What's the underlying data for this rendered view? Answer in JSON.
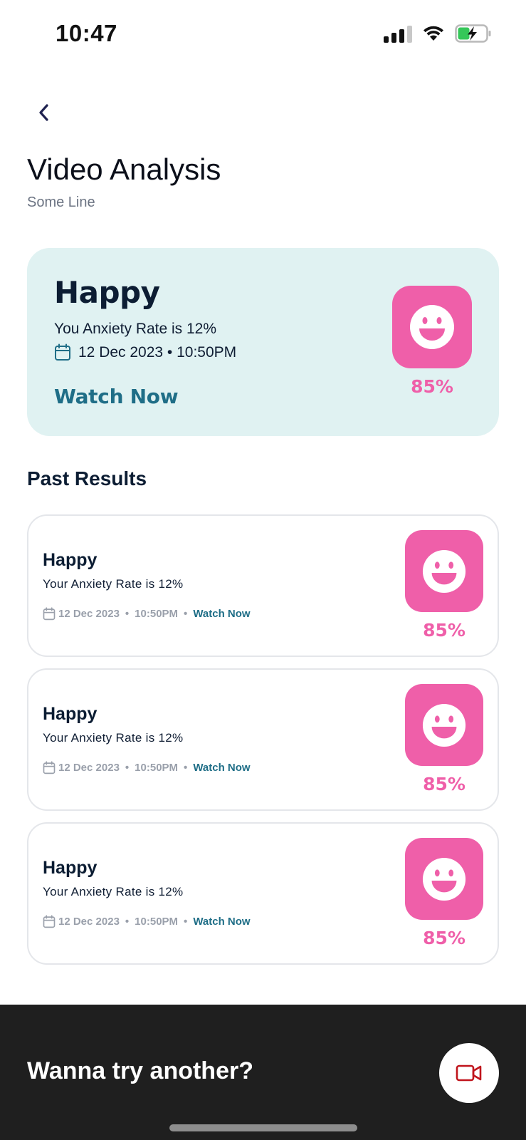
{
  "status_bar": {
    "time": "10:47",
    "icons": [
      "cellular-signal-icon",
      "wifi-icon",
      "battery-charging-icon"
    ]
  },
  "header": {
    "back_icon": "chevron-left-icon",
    "title": "Video Analysis",
    "subtitle": "Some Line"
  },
  "hero": {
    "mood": "Happy",
    "rate_text": "You Anxiety Rate is 12%",
    "date_icon": "calendar-icon",
    "datetime": "12 Dec 2023 • 10:50PM",
    "watch_label": "Watch Now",
    "face_icon": "smiley-face-icon",
    "percent": "85%"
  },
  "past_results": {
    "title": "Past Results",
    "items": [
      {
        "mood": "Happy",
        "rate_text": "Your Anxiety Rate is 12%",
        "date": "12 Dec 2023",
        "time": "10:50PM",
        "watch_label": "Watch Now",
        "percent": "85%"
      },
      {
        "mood": "Happy",
        "rate_text": "Your Anxiety Rate is 12%",
        "date": "12 Dec 2023",
        "time": "10:50PM",
        "watch_label": "Watch Now",
        "percent": "85%"
      },
      {
        "mood": "Happy",
        "rate_text": "Your Anxiety Rate is 12%",
        "date": "12 Dec 2023",
        "time": "10:50PM",
        "watch_label": "Watch Now",
        "percent": "85%"
      }
    ]
  },
  "bottom_bar": {
    "prompt": "Wanna try another?",
    "record_icon": "video-camera-icon"
  },
  "colors": {
    "accent_pink": "#ef5fa9",
    "accent_teal": "#1f6e87",
    "hero_bg": "#e0f2f2",
    "dark_bar": "#1f1f1f",
    "record_icon_red": "#c0141c"
  }
}
